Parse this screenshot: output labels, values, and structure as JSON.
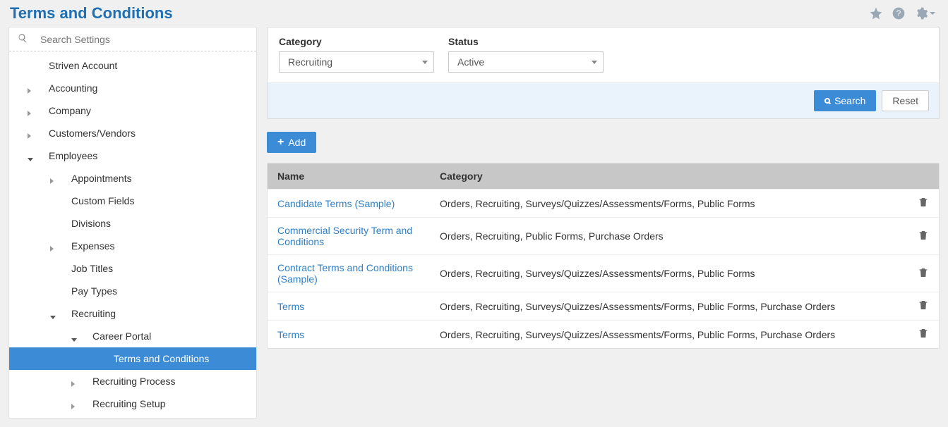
{
  "header": {
    "title": "Terms and Conditions"
  },
  "search": {
    "placeholder": "Search Settings"
  },
  "sidebar": {
    "items": [
      {
        "label": "Striven Account",
        "depth": 0,
        "expander": "none"
      },
      {
        "label": "Accounting",
        "depth": 0,
        "expander": "right"
      },
      {
        "label": "Company",
        "depth": 0,
        "expander": "right"
      },
      {
        "label": "Customers/Vendors",
        "depth": 0,
        "expander": "right"
      },
      {
        "label": "Employees",
        "depth": 0,
        "expander": "down"
      },
      {
        "label": "Appointments",
        "depth": 1,
        "expander": "right"
      },
      {
        "label": "Custom Fields",
        "depth": 1,
        "expander": "none"
      },
      {
        "label": "Divisions",
        "depth": 1,
        "expander": "none"
      },
      {
        "label": "Expenses",
        "depth": 1,
        "expander": "right"
      },
      {
        "label": "Job Titles",
        "depth": 1,
        "expander": "none"
      },
      {
        "label": "Pay Types",
        "depth": 1,
        "expander": "none"
      },
      {
        "label": "Recruiting",
        "depth": 1,
        "expander": "down"
      },
      {
        "label": "Career Portal",
        "depth": 2,
        "expander": "down"
      },
      {
        "label": "Terms and Conditions",
        "depth": 3,
        "expander": "none",
        "selected": true
      },
      {
        "label": "Recruiting Process",
        "depth": 2,
        "expander": "right"
      },
      {
        "label": "Recruiting Setup",
        "depth": 2,
        "expander": "right"
      }
    ]
  },
  "filters": {
    "category_label": "Category",
    "status_label": "Status",
    "category_value": "Recruiting",
    "status_value": "Active",
    "search_btn": "Search",
    "reset_btn": "Reset"
  },
  "add_btn": "Add",
  "table": {
    "headers": {
      "name": "Name",
      "category": "Category"
    },
    "rows": [
      {
        "name": "Candidate Terms (Sample)",
        "category": "Orders, Recruiting, Surveys/Quizzes/Assessments/Forms, Public Forms"
      },
      {
        "name": "Commercial Security Term and Conditions",
        "category": "Orders, Recruiting, Public Forms, Purchase Orders"
      },
      {
        "name": "Contract Terms and Conditions (Sample)",
        "category": "Orders, Recruiting, Surveys/Quizzes/Assessments/Forms, Public Forms"
      },
      {
        "name": "Terms",
        "category": "Orders, Recruiting, Surveys/Quizzes/Assessments/Forms, Public Forms, Purchase Orders"
      },
      {
        "name": "Terms",
        "category": "Orders, Recruiting, Surveys/Quizzes/Assessments/Forms, Public Forms, Purchase Orders"
      }
    ]
  }
}
